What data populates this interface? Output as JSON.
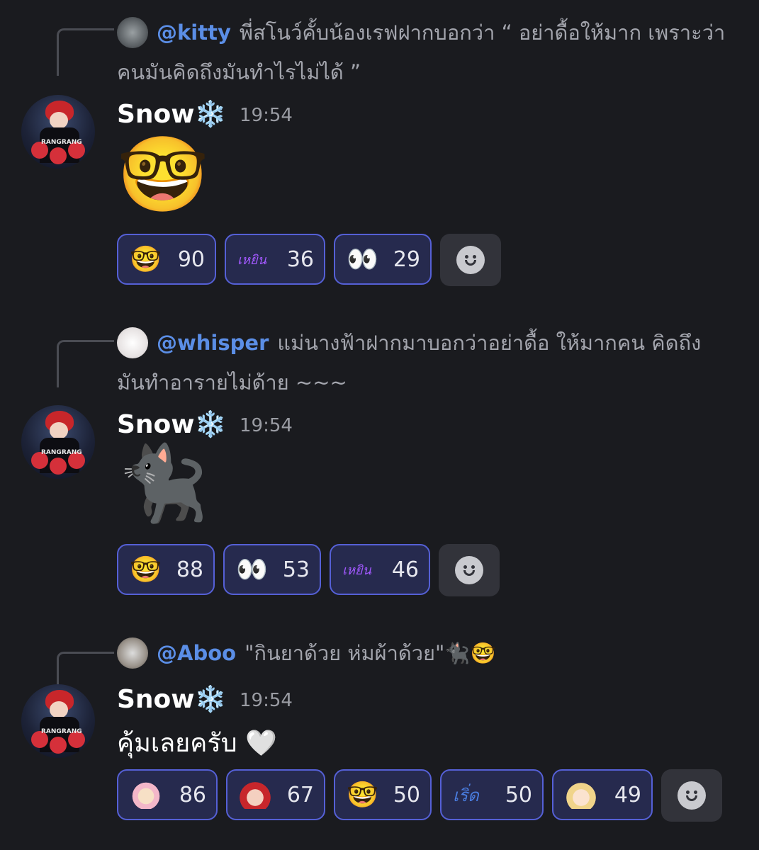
{
  "messages": [
    {
      "reply": {
        "mention": "@kitty",
        "text": "พี่สโนว์คั้บน้องเรฟฝากบอกว่า “ อย่าดื้อให้มาก เพราะว่าคนมันคิดถึงมันทำไรไม่ได้ ”"
      },
      "author": "Snow❄️",
      "time": "19:54",
      "content": "🤓",
      "reactions": [
        {
          "emoji": "🤓",
          "count": "90"
        },
        {
          "emoji": "เหยิน",
          "count": "36"
        },
        {
          "emoji": "👀",
          "count": "29"
        }
      ]
    },
    {
      "reply": {
        "mention": "@whisper",
        "text": "แม่นางฟ้าฝากมาบอกว่าอย่าดื้อ ให้มากคน คิดถึงมันทำอารายไม่ด้าย ~~~"
      },
      "author": "Snow❄️",
      "time": "19:54",
      "content": "🐈‍⬛",
      "reactions": [
        {
          "emoji": "🤓",
          "count": "88"
        },
        {
          "emoji": "👀",
          "count": "53"
        },
        {
          "emoji": "เหยิน",
          "count": "46"
        }
      ]
    },
    {
      "reply": {
        "mention": "@Aboo",
        "text": "\"กินยาด้วย ห่มผ้าด้วย\"🐈‍⬛🤓"
      },
      "author": "Snow❄️",
      "time": "19:54",
      "content": "คุ้มเลยครับ 🤍",
      "reactions": [
        {
          "emoji": "pink-bunny-sticker",
          "count": "86"
        },
        {
          "emoji": "5555",
          "count": "67"
        },
        {
          "emoji": "🤓",
          "count": "50"
        },
        {
          "emoji": "เริ่ด",
          "count": "50"
        },
        {
          "emoji": "เขินมาก",
          "count": "49"
        }
      ]
    }
  ],
  "colors": {
    "background": "#1a1b1f",
    "mention": "#5b8ee6",
    "reaction_border": "#5560d6",
    "reaction_bg": "#262a4e"
  }
}
